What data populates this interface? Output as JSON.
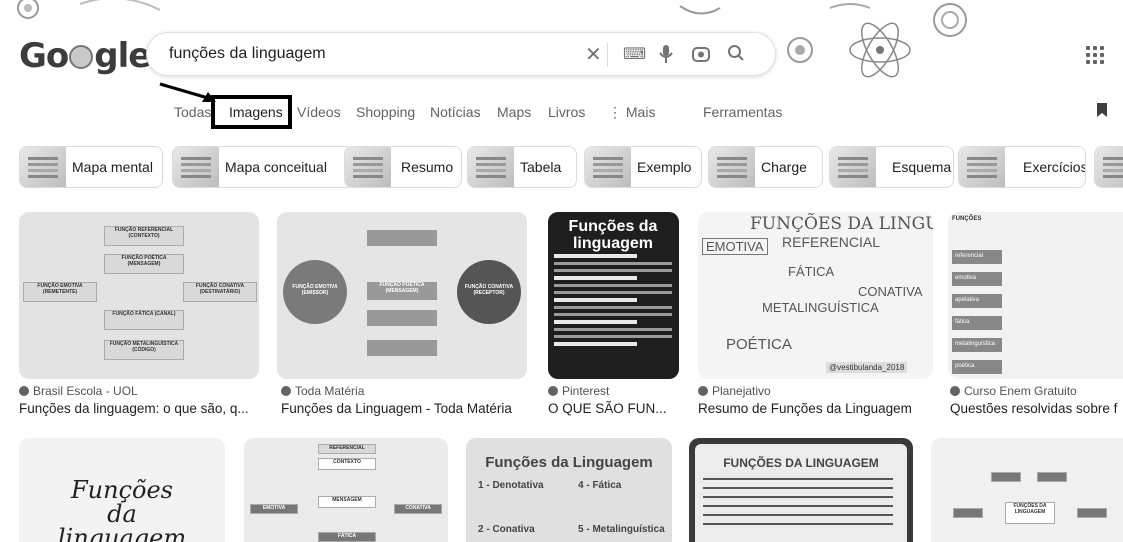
{
  "logo": "Google",
  "search": {
    "query": "funções da linguagem",
    "clear_icon": "close-icon",
    "keyboard_icon": "keyboard-icon",
    "voice_icon": "microphone-icon",
    "lens_icon": "camera-lens-icon",
    "search_icon": "search-icon"
  },
  "tabs": [
    "Todas",
    "Imagens",
    "Vídeos",
    "Shopping",
    "Notícias",
    "Maps",
    "Livros",
    "⋮ Mais",
    "Ferramentas"
  ],
  "active_tab": "Imagens",
  "chips": [
    "Mapa mental",
    "Mapa conceitual",
    "Resumo",
    "Tabela",
    "Exemplo",
    "Charge",
    "Esquema",
    "Exercícios"
  ],
  "results": [
    {
      "source": "Brasil Escola - UOL",
      "title": "Funções da linguagem: o que são, q...",
      "image_labels": [
        "FUNÇÃO REFERENCIAL (CONTEXTO)",
        "FUNÇÃO POÉTICA (MENSAGEM)",
        "FUNÇÃO EMOTIVA (REMETENTE)",
        "FUNÇÃO CONATIVA (DESTINATÁRIO)",
        "FUNÇÃO FÁTICA (CANAL)",
        "FUNÇÃO METALINGUÍSTICA (CÓDIGO)"
      ]
    },
    {
      "source": "Toda Matéria",
      "title": "Funções da Linguagem - Toda Matéria",
      "image_labels": [
        "FUNÇÃO EMOTIVA (EMISSOR)",
        "FUNÇÃO CONATIVA (RECEPTOR)",
        "FUNÇÃO POÉTICA (MENSAGEM)"
      ]
    },
    {
      "source": "Pinterest",
      "title": "O QUE SÃO FUN...",
      "image_labels": [
        "Funções da linguagem",
        "Referencial ou denotativa",
        "Emotiva ou expressiva",
        "Poética",
        "Conativa ou apelativa",
        "Metalinguística"
      ]
    },
    {
      "source": "Planejativo",
      "title": "Resumo de Funções da Linguagem",
      "image_labels": [
        "FUNÇÕES DA LINGUAGEM",
        "EMOTIVA",
        "REFERENCIAL",
        "FÁTICA",
        "CONATIVA",
        "METALINGUÍSTICA",
        "POÉTICA",
        "@vestibulanda_2018"
      ]
    },
    {
      "source": "Curso Enem Gratuito",
      "title": "Questões resolvidas sobre f",
      "image_labels": [
        "FUNÇÕES",
        "referencial",
        "emotiva",
        "apelativa",
        "fática",
        "metalinguística",
        "poética"
      ]
    }
  ],
  "row2_labels": {
    "card1": "Funções da linguagem",
    "card2": [
      "REFERENCIAL",
      "CONTEXTO",
      "MENSAGEM",
      "EMOTIVA",
      "CONATIVA",
      "FÁTICA"
    ],
    "card3": [
      "Funções da Linguagem",
      "1 - Denotativa",
      "4 - Fática",
      "2 - Conativa",
      "5 - Metalinguística"
    ],
    "card4": "FUNÇÕES DA LINGUAGEM",
    "card5": "FUNÇÕES DA LINGUAGEM"
  }
}
